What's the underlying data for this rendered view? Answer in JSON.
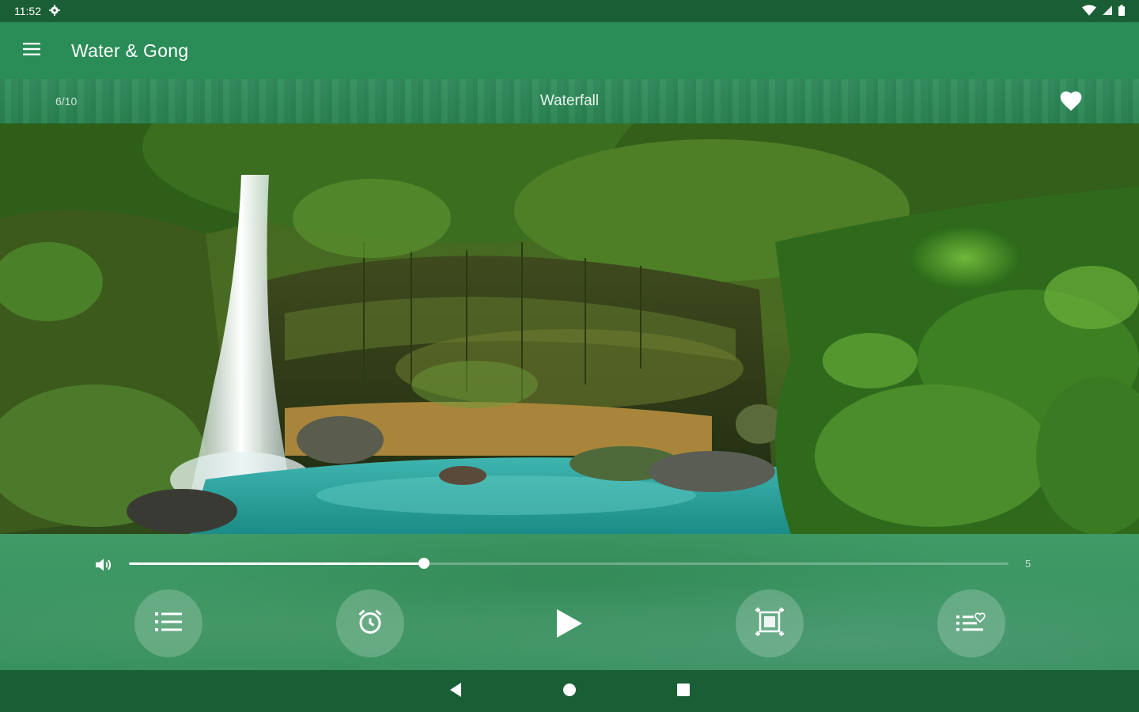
{
  "status_bar": {
    "time": "11:52",
    "settings_icon": "gear-icon",
    "wifi_icon": "wifi-icon",
    "signal_icon": "signal-icon",
    "battery_icon": "battery-icon"
  },
  "app_bar": {
    "menu_icon": "hamburger-menu-icon",
    "title": "Water & Gong"
  },
  "track": {
    "counter": "6/10",
    "title": "Waterfall",
    "favorite_icon": "heart-icon"
  },
  "volume": {
    "icon": "volume-icon",
    "level_fraction": 0.335,
    "max_label": "5"
  },
  "controls": [
    {
      "name": "playlist-button",
      "icon": "list-icon"
    },
    {
      "name": "timer-button",
      "icon": "alarm-clock-icon"
    },
    {
      "name": "play-button",
      "icon": "play-icon"
    },
    {
      "name": "fullscreen-button",
      "icon": "frame-icon"
    },
    {
      "name": "favorites-list-button",
      "icon": "heart-list-icon"
    }
  ],
  "nav_bar": {
    "back_icon": "back-triangle-icon",
    "home_icon": "home-circle-icon",
    "recents_icon": "recents-square-icon"
  },
  "colors": {
    "status_bar": "#1a5e36",
    "app_bar": "#2a8c57",
    "controls_panel": "#3a9563",
    "accent": "#ffffff"
  }
}
